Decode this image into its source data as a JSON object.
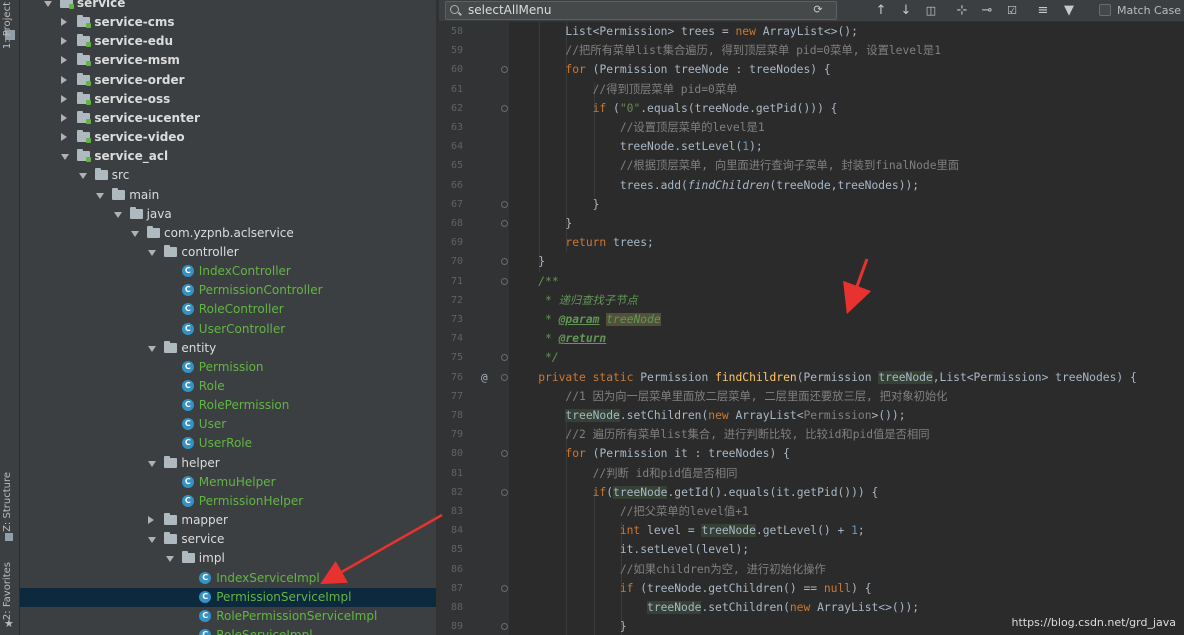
{
  "tool_strip": {
    "project_tab": "1: Project",
    "structure_tab": "Z: Structure",
    "favorites_tab": "2: Favorites"
  },
  "project_tree": [
    {
      "label": "service",
      "depth": 0,
      "kind": "module",
      "expanded": true
    },
    {
      "label": "service-cms",
      "depth": 1,
      "kind": "module",
      "expanded": false
    },
    {
      "label": "service-edu",
      "depth": 1,
      "kind": "module",
      "expanded": false
    },
    {
      "label": "service-msm",
      "depth": 1,
      "kind": "module",
      "expanded": false
    },
    {
      "label": "service-order",
      "depth": 1,
      "kind": "module",
      "expanded": false
    },
    {
      "label": "service-oss",
      "depth": 1,
      "kind": "module",
      "expanded": false
    },
    {
      "label": "service-ucenter",
      "depth": 1,
      "kind": "module",
      "expanded": false
    },
    {
      "label": "service-video",
      "depth": 1,
      "kind": "module",
      "expanded": false
    },
    {
      "label": "service_acl",
      "depth": 1,
      "kind": "module",
      "expanded": true
    },
    {
      "label": "src",
      "depth": 2,
      "kind": "folder",
      "expanded": true
    },
    {
      "label": "main",
      "depth": 3,
      "kind": "folder",
      "expanded": true
    },
    {
      "label": "java",
      "depth": 4,
      "kind": "folder",
      "expanded": true
    },
    {
      "label": "com.yzpnb.aclservice",
      "depth": 5,
      "kind": "package",
      "expanded": true
    },
    {
      "label": "controller",
      "depth": 6,
      "kind": "package",
      "expanded": true
    },
    {
      "label": "IndexController",
      "depth": 7,
      "kind": "class"
    },
    {
      "label": "PermissionController",
      "depth": 7,
      "kind": "class"
    },
    {
      "label": "RoleController",
      "depth": 7,
      "kind": "class"
    },
    {
      "label": "UserController",
      "depth": 7,
      "kind": "class"
    },
    {
      "label": "entity",
      "depth": 6,
      "kind": "package",
      "expanded": true
    },
    {
      "label": "Permission",
      "depth": 7,
      "kind": "class"
    },
    {
      "label": "Role",
      "depth": 7,
      "kind": "class"
    },
    {
      "label": "RolePermission",
      "depth": 7,
      "kind": "class"
    },
    {
      "label": "User",
      "depth": 7,
      "kind": "class"
    },
    {
      "label": "UserRole",
      "depth": 7,
      "kind": "class"
    },
    {
      "label": "helper",
      "depth": 6,
      "kind": "package",
      "expanded": true
    },
    {
      "label": "MemuHelper",
      "depth": 7,
      "kind": "class"
    },
    {
      "label": "PermissionHelper",
      "depth": 7,
      "kind": "class"
    },
    {
      "label": "mapper",
      "depth": 6,
      "kind": "package",
      "expanded": false
    },
    {
      "label": "service",
      "depth": 6,
      "kind": "package",
      "expanded": true
    },
    {
      "label": "impl",
      "depth": 7,
      "kind": "package",
      "expanded": true
    },
    {
      "label": "IndexServiceImpl",
      "depth": 8,
      "kind": "class"
    },
    {
      "label": "PermissionServiceImpl",
      "depth": 8,
      "kind": "class",
      "selected": true
    },
    {
      "label": "RolePermissionServiceImpl",
      "depth": 8,
      "kind": "class"
    },
    {
      "label": "RoleServiceImpl",
      "depth": 8,
      "kind": "class"
    }
  ],
  "search": {
    "value": "selectAllMenu",
    "match_case_label": "Match Case"
  },
  "toolbar_icons": [
    "reset-search-icon",
    "arrow-up-icon",
    "arrow-down-icon",
    "select-all-occurrences-icon",
    "add-selection-icon",
    "remove-selection-icon",
    "toggle-select-icon",
    "multiline-icon",
    "filter-icon"
  ],
  "gutter": {
    "override_marker_line": "76",
    "override_marker": "@"
  },
  "code_lines": [
    {
      "n": "58",
      "tokens": [
        [
          "        ",
          ""
        ],
        [
          "List<Permission> trees = ",
          ""
        ],
        [
          "new ",
          "kw"
        ],
        [
          "ArrayList<>();",
          ""
        ]
      ]
    },
    {
      "n": "59",
      "tokens": [
        [
          "        ",
          ""
        ],
        [
          "//把所有菜单list集合遍历, 得到顶层菜单 pid=0菜单, 设置level是1",
          "cm"
        ]
      ]
    },
    {
      "n": "60",
      "tokens": [
        [
          "        ",
          ""
        ],
        [
          "for ",
          "kw"
        ],
        [
          "(Permission treeNode : treeNodes) {",
          ""
        ]
      ]
    },
    {
      "n": "61",
      "tokens": [
        [
          "            ",
          ""
        ],
        [
          "//得到顶层菜单 pid=0菜单",
          "cm"
        ]
      ]
    },
    {
      "n": "62",
      "tokens": [
        [
          "            ",
          ""
        ],
        [
          "if ",
          "kw"
        ],
        [
          "(",
          ""
        ],
        [
          "\"0\"",
          "str"
        ],
        [
          ".equals(treeNode.getPid())) {",
          ""
        ]
      ]
    },
    {
      "n": "63",
      "tokens": [
        [
          "                ",
          ""
        ],
        [
          "//设置顶层菜单的level是1",
          "cm"
        ]
      ]
    },
    {
      "n": "64",
      "tokens": [
        [
          "                ",
          ""
        ],
        [
          "treeNode.setLevel(",
          ""
        ],
        [
          "1",
          "num"
        ],
        [
          ");",
          ""
        ]
      ]
    },
    {
      "n": "65",
      "tokens": [
        [
          "                ",
          ""
        ],
        [
          "//根据顶层菜单, 向里面进行查询子菜单, 封装到finalNode里面",
          "cm"
        ]
      ]
    },
    {
      "n": "66",
      "tokens": [
        [
          "                ",
          ""
        ],
        [
          "trees.add(",
          ""
        ],
        [
          "findChildren",
          "it"
        ],
        [
          "(treeNode,treeNodes));",
          ""
        ]
      ]
    },
    {
      "n": "67",
      "tokens": [
        [
          "            ",
          ""
        ],
        [
          "}",
          ""
        ]
      ]
    },
    {
      "n": "68",
      "tokens": [
        [
          "        ",
          ""
        ],
        [
          "}",
          ""
        ]
      ]
    },
    {
      "n": "69",
      "tokens": [
        [
          "        ",
          ""
        ],
        [
          "return ",
          "kw"
        ],
        [
          "trees;",
          ""
        ]
      ]
    },
    {
      "n": "70",
      "tokens": [
        [
          "    ",
          ""
        ],
        [
          "}",
          ""
        ]
      ]
    },
    {
      "n": "71",
      "tokens": [
        [
          "    ",
          ""
        ],
        [
          "/**",
          "doc"
        ]
      ]
    },
    {
      "n": "72",
      "tokens": [
        [
          "     ",
          ""
        ],
        [
          "* 递归查找子节点",
          "doc"
        ]
      ]
    },
    {
      "n": "73",
      "tokens": [
        [
          "     ",
          ""
        ],
        [
          "* ",
          "doc"
        ],
        [
          "@param",
          "doctag"
        ],
        [
          " ",
          "doc"
        ],
        [
          "treeNode",
          "hlb doc"
        ]
      ]
    },
    {
      "n": "74",
      "tokens": [
        [
          "     ",
          ""
        ],
        [
          "* ",
          "doc"
        ],
        [
          "@return",
          "doctag"
        ]
      ]
    },
    {
      "n": "75",
      "tokens": [
        [
          "     ",
          ""
        ],
        [
          "*/",
          "doc"
        ]
      ]
    },
    {
      "n": "76",
      "tokens": [
        [
          "    ",
          ""
        ],
        [
          "private static ",
          "kw"
        ],
        [
          "Permission ",
          ""
        ],
        [
          "findChildren",
          "fn"
        ],
        [
          "(Permission ",
          ""
        ],
        [
          "treeNode",
          "hl"
        ],
        [
          ",List<Permission> treeNodes) {",
          ""
        ]
      ]
    },
    {
      "n": "77",
      "tokens": [
        [
          "        ",
          ""
        ],
        [
          "//1 因为向一层菜单里面放二层菜单, 二层里面还要放三层, 把对象初始化",
          "cm"
        ]
      ]
    },
    {
      "n": "78",
      "tokens": [
        [
          "        ",
          ""
        ],
        [
          "treeNode",
          "hl"
        ],
        [
          ".setChildren(",
          ""
        ],
        [
          "new ",
          "kw"
        ],
        [
          "ArrayList<",
          ""
        ],
        [
          "Permission",
          "cm"
        ],
        [
          ">());",
          ""
        ]
      ]
    },
    {
      "n": "79",
      "tokens": [
        [
          "        ",
          ""
        ],
        [
          "//2 遍历所有菜单list集合, 进行判断比较, 比较id和pid值是否相同",
          "cm"
        ]
      ]
    },
    {
      "n": "80",
      "tokens": [
        [
          "        ",
          ""
        ],
        [
          "for ",
          "kw"
        ],
        [
          "(Permission it : treeNodes) {",
          ""
        ]
      ]
    },
    {
      "n": "81",
      "tokens": [
        [
          "            ",
          ""
        ],
        [
          "//判断 id和pid值是否相同",
          "cm"
        ]
      ]
    },
    {
      "n": "82",
      "tokens": [
        [
          "            ",
          ""
        ],
        [
          "if",
          "kw"
        ],
        [
          "(",
          ""
        ],
        [
          "treeNode",
          "hl"
        ],
        [
          ".getId().equals(it.getPid())) {",
          ""
        ]
      ]
    },
    {
      "n": "83",
      "tokens": [
        [
          "                ",
          ""
        ],
        [
          "//把父菜单的level值+1",
          "cm"
        ]
      ]
    },
    {
      "n": "84",
      "tokens": [
        [
          "                ",
          ""
        ],
        [
          "int ",
          "kw"
        ],
        [
          "level = ",
          ""
        ],
        [
          "treeNode",
          "hl"
        ],
        [
          ".getLevel() + ",
          ""
        ],
        [
          "1",
          "num"
        ],
        [
          ";",
          ""
        ]
      ]
    },
    {
      "n": "85",
      "tokens": [
        [
          "                ",
          ""
        ],
        [
          "it.setLevel(level);",
          ""
        ]
      ]
    },
    {
      "n": "86",
      "tokens": [
        [
          "                ",
          ""
        ],
        [
          "//如果children为空, 进行初始化操作",
          "cm"
        ]
      ]
    },
    {
      "n": "87",
      "tokens": [
        [
          "                ",
          ""
        ],
        [
          "if ",
          "kw"
        ],
        [
          "(treeNode.getChildren() == ",
          ""
        ],
        [
          "null",
          "kw"
        ],
        [
          ") {",
          ""
        ]
      ]
    },
    {
      "n": "88",
      "tokens": [
        [
          "                    ",
          ""
        ],
        [
          "treeNode",
          "hl"
        ],
        [
          ".setChildren(",
          ""
        ],
        [
          "new ",
          "kw"
        ],
        [
          "ArrayList<>());",
          ""
        ]
      ]
    },
    {
      "n": "89",
      "tokens": [
        [
          "                ",
          ""
        ],
        [
          "}",
          ""
        ]
      ]
    }
  ],
  "watermark": "https://blog.csdn.net/grd_java",
  "colors": {
    "annotation_arrow": "#e8322f",
    "selection": "#0d293e"
  }
}
